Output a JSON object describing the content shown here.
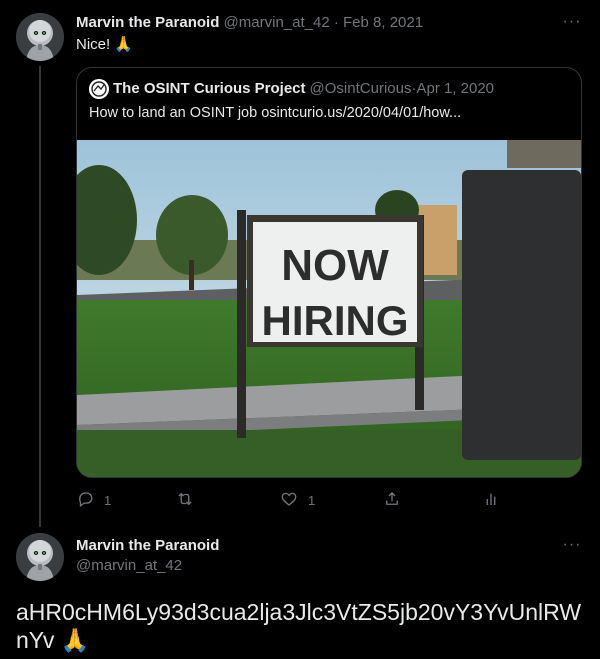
{
  "tweet1": {
    "author_name": "Marvin the Paranoid",
    "author_handle": "@marvin_at_42",
    "separator": " · ",
    "date": "Feb 8, 2021",
    "text": "Nice! 🙏",
    "more_glyph": "···"
  },
  "quote": {
    "author_name": "The OSINT Curious Project",
    "author_handle": "@OsintCurious",
    "separator": " · ",
    "date": "Apr 1, 2020",
    "text": "How to land an OSINT job osintcurio.us/2020/04/01/how...",
    "image_sign_line1": "NOW",
    "image_sign_line2": "HIRING"
  },
  "actions": {
    "reply_count": "1",
    "retweet_count": "",
    "like_count": "1",
    "icons": [
      "reply-icon",
      "retweet-icon",
      "like-icon",
      "share-icon",
      "analytics-icon"
    ]
  },
  "tweet2": {
    "author_name": "Marvin the Paranoid",
    "author_handle": "@marvin_at_42",
    "text": "aHR0cHM6Ly93d3cua2lja3Jlc3VtZS5jb20vY3YvUnlRWnYv 🙏",
    "more_glyph": "···"
  },
  "colors": {
    "background": "#000000",
    "text": "#e7e9ea",
    "muted": "#71767b",
    "border": "#2f3336"
  }
}
